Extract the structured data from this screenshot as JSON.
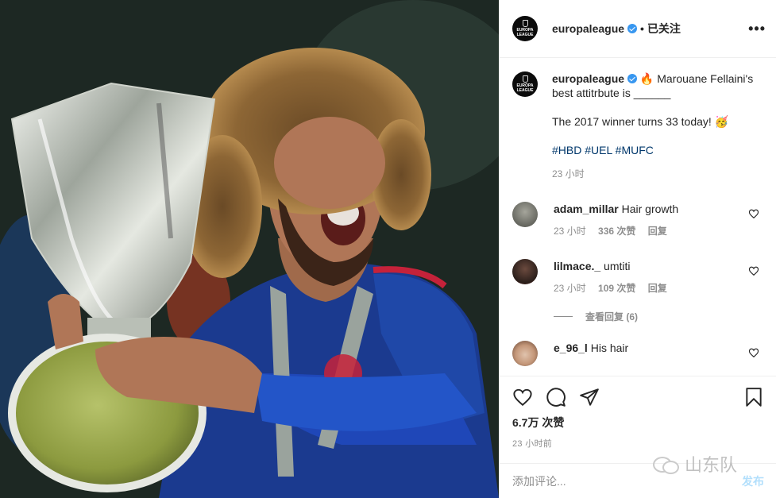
{
  "post": {
    "account": "europaleague",
    "follow_label": "已关注",
    "separator": "•",
    "more_label": "•••",
    "avatar_logo_line1": "EUROPA",
    "avatar_logo_line2": "LEAGUE"
  },
  "caption": {
    "username": "europaleague",
    "line1": "🔥 Marouane Fellaini's best attitrbute is ______",
    "line2": "The 2017 winner turns 33 today! 🥳",
    "hashtags": [
      "#HBD",
      "#UEL",
      "#MUFC"
    ],
    "time": "23 小时"
  },
  "comments": [
    {
      "username": "adam_millar",
      "text": "Hair growth",
      "time": "23 小时",
      "likes": "336 次赞",
      "reply": "回复",
      "avatar_color": "#7a7a72"
    },
    {
      "username": "lilmace._",
      "text": "umtiti",
      "time": "23 小时",
      "likes": "109 次赞",
      "reply": "回复",
      "avatar_color": "#3a2a26",
      "view_replies": "查看回复 (6)"
    },
    {
      "username": "e_96_l",
      "text": "His hair",
      "avatar_color": "#c8a58e"
    }
  ],
  "actions": {
    "like_icon": "heart-icon",
    "comment_icon": "comment-icon",
    "share_icon": "share-icon",
    "save_icon": "bookmark-icon",
    "likes": "6.7万 次赞",
    "time": "23 小时前"
  },
  "add_comment": {
    "placeholder": "添加评论...",
    "post_label": "发布"
  },
  "watermark": {
    "text": "山东队"
  },
  "colors": {
    "accent": "#3897f0",
    "hashtag": "#00376b",
    "muted": "#8e8e8e",
    "post_disabled": "#b2dffc"
  }
}
